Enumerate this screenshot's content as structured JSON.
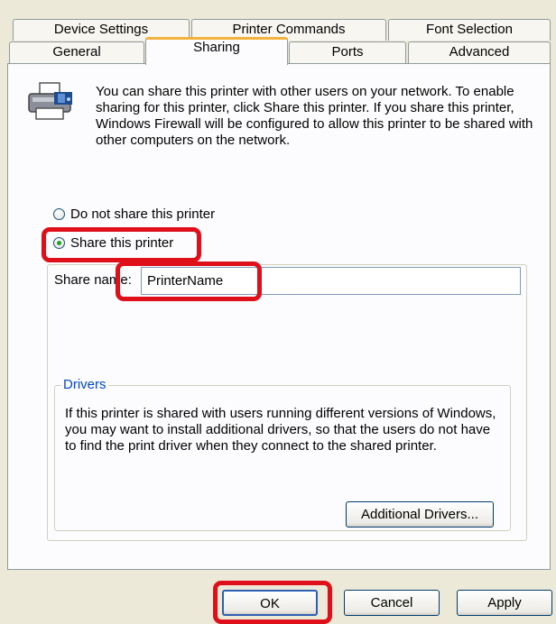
{
  "tabs_row1": [
    "Device Settings",
    "Printer Commands",
    "Font Selection"
  ],
  "tabs_row2": [
    "General",
    "Sharing",
    "Ports",
    "Advanced"
  ],
  "active_tab": "Sharing",
  "description": "You can share this printer with other users on your network.  To enable sharing for this printer, click Share this printer.  If you share this printer, Windows Firewall will be configured to allow this printer to be shared with other computers on the network.",
  "options": {
    "do_not_share": "Do not share this printer",
    "share": "Share this printer",
    "selected": "share"
  },
  "share_name": {
    "label": "Share name:",
    "value": "PrinterName"
  },
  "drivers": {
    "legend": "Drivers",
    "text": "If this printer is shared with users running different versions of Windows, you may want to install additional drivers, so that the users do not have to find the print driver when they connect to the shared printer.",
    "button": "Additional Drivers..."
  },
  "buttons": {
    "ok": "OK",
    "cancel": "Cancel",
    "apply": "Apply"
  },
  "icons": {
    "printer": "printer-share-icon"
  },
  "colors": {
    "highlight": "#e0101a",
    "groupbox_title": "#0046d5",
    "active_tab_accent": "#f2b33d"
  }
}
